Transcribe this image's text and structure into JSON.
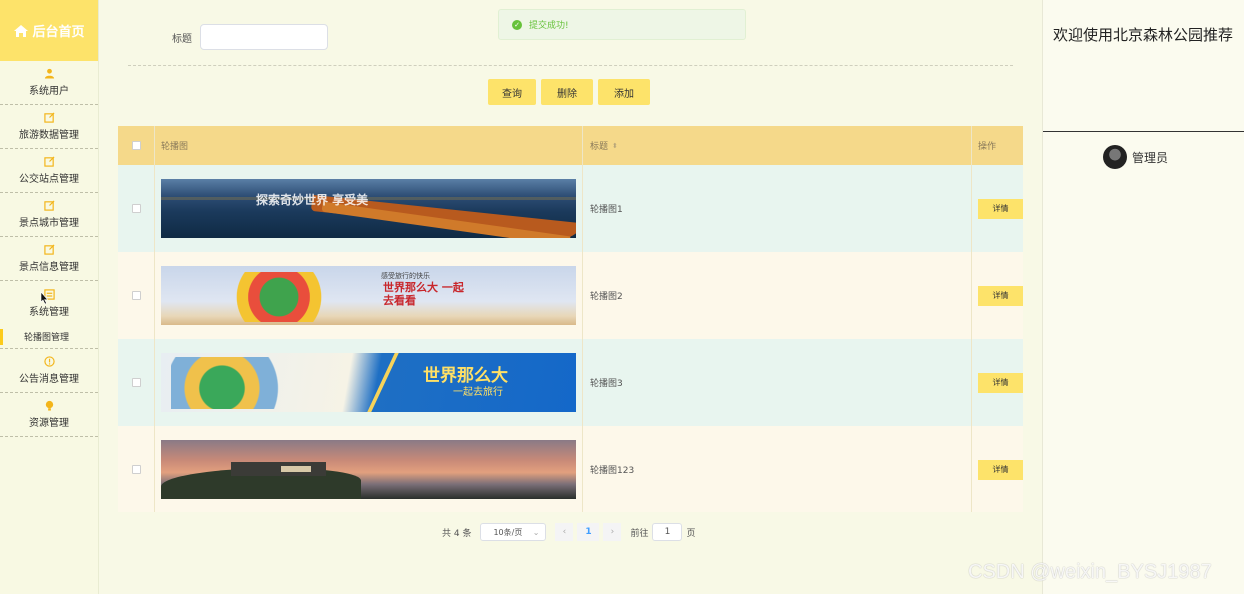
{
  "sidebar": {
    "brand": "后台首页",
    "items": [
      {
        "label": "系统用户",
        "icon": "user-icon"
      },
      {
        "label": "旅游数据管理",
        "icon": "edit-icon"
      },
      {
        "label": "公交站点管理",
        "icon": "edit-icon"
      },
      {
        "label": "景点城市管理",
        "icon": "edit-icon"
      },
      {
        "label": "景点信息管理",
        "icon": "edit-icon"
      },
      {
        "label": "系统管理",
        "icon": "settings-icon"
      },
      {
        "label": "公告消息管理",
        "icon": "info-icon"
      },
      {
        "label": "资源管理",
        "icon": "bulb-icon"
      }
    ],
    "submenu": {
      "label": "轮播图管理"
    }
  },
  "search": {
    "label": "标题",
    "value": "",
    "placeholder": ""
  },
  "toast": {
    "message": "提交成功!",
    "color": "#67c23a"
  },
  "buttons": {
    "query": "查询",
    "delete": "删除",
    "add": "添加"
  },
  "table": {
    "columns": {
      "image": "轮播图",
      "title": "标题",
      "actions": "操作"
    },
    "rows": [
      {
        "title": "轮播图1",
        "banner_caption": "探索奇妙世界 享受美",
        "action": "详情"
      },
      {
        "title": "轮播图2",
        "banner_caption": "世界那么大 一起去看看",
        "banner_sub": "感受旅行的快乐",
        "action": "详情"
      },
      {
        "title": "轮播图3",
        "banner_caption": "世界那么大",
        "banner_sub": "一起去旅行",
        "action": "详情"
      },
      {
        "title": "轮播图123",
        "action": "详情"
      }
    ]
  },
  "pagination": {
    "total": "共 4 条",
    "page_size": "10条/页",
    "current_page": "1",
    "goto_label": "前往",
    "goto_value": "1",
    "page_suffix": "页"
  },
  "right_panel": {
    "welcome": "欢迎使用北京森林公园推荐",
    "user": "管理员"
  },
  "watermark": "CSDN @weixin_BYSJ1987",
  "colors": {
    "accent": "#fde36a",
    "table_header": "#f5d98a",
    "row_even": "#e8f5ef",
    "row_odd": "#fdf8ea"
  }
}
